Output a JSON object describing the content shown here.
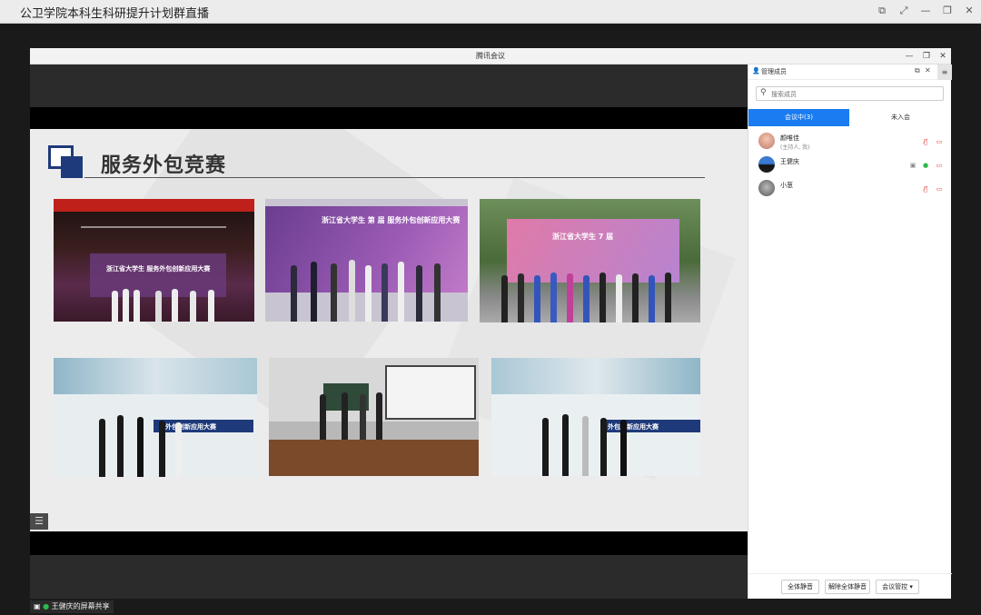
{
  "outer": {
    "title": "公卫学院本科生科研提升计划群直播"
  },
  "meeting": {
    "window_title": "腾讯会议",
    "share_label": "王健庆的屏幕共享"
  },
  "slide": {
    "title": "服务外包竞赛",
    "photos": [
      {
        "banner": "浙江省大学生 服务外包创新应用大赛"
      },
      {
        "banner": "浙江省大学生 第 届 服务外包创新应用大赛"
      },
      {
        "banner": "浙江省大学生 7 届"
      },
      {
        "banner": "务外包创新应用大赛"
      },
      {
        "banner": ""
      },
      {
        "banner": "外包创新应用大赛"
      }
    ]
  },
  "panel": {
    "title": "管理成员",
    "search_placeholder": "搜索成员",
    "tabs": [
      {
        "label": "会议中(3)"
      },
      {
        "label": "未入会"
      }
    ],
    "members": [
      {
        "name": "颜唯佳",
        "role": "(主持人, 我)"
      },
      {
        "name": "王健庆",
        "role": ""
      },
      {
        "name": "小葱",
        "role": ""
      }
    ],
    "buttons": {
      "mute_all": "全体静音",
      "unmute_all": "解除全体静音",
      "control": "会议管控"
    }
  },
  "colors": {
    "accent": "#1a7cf0",
    "muted": "#e03c3c",
    "mic_on": "#2db84d",
    "slide_title_box": "#1f3a7a"
  }
}
